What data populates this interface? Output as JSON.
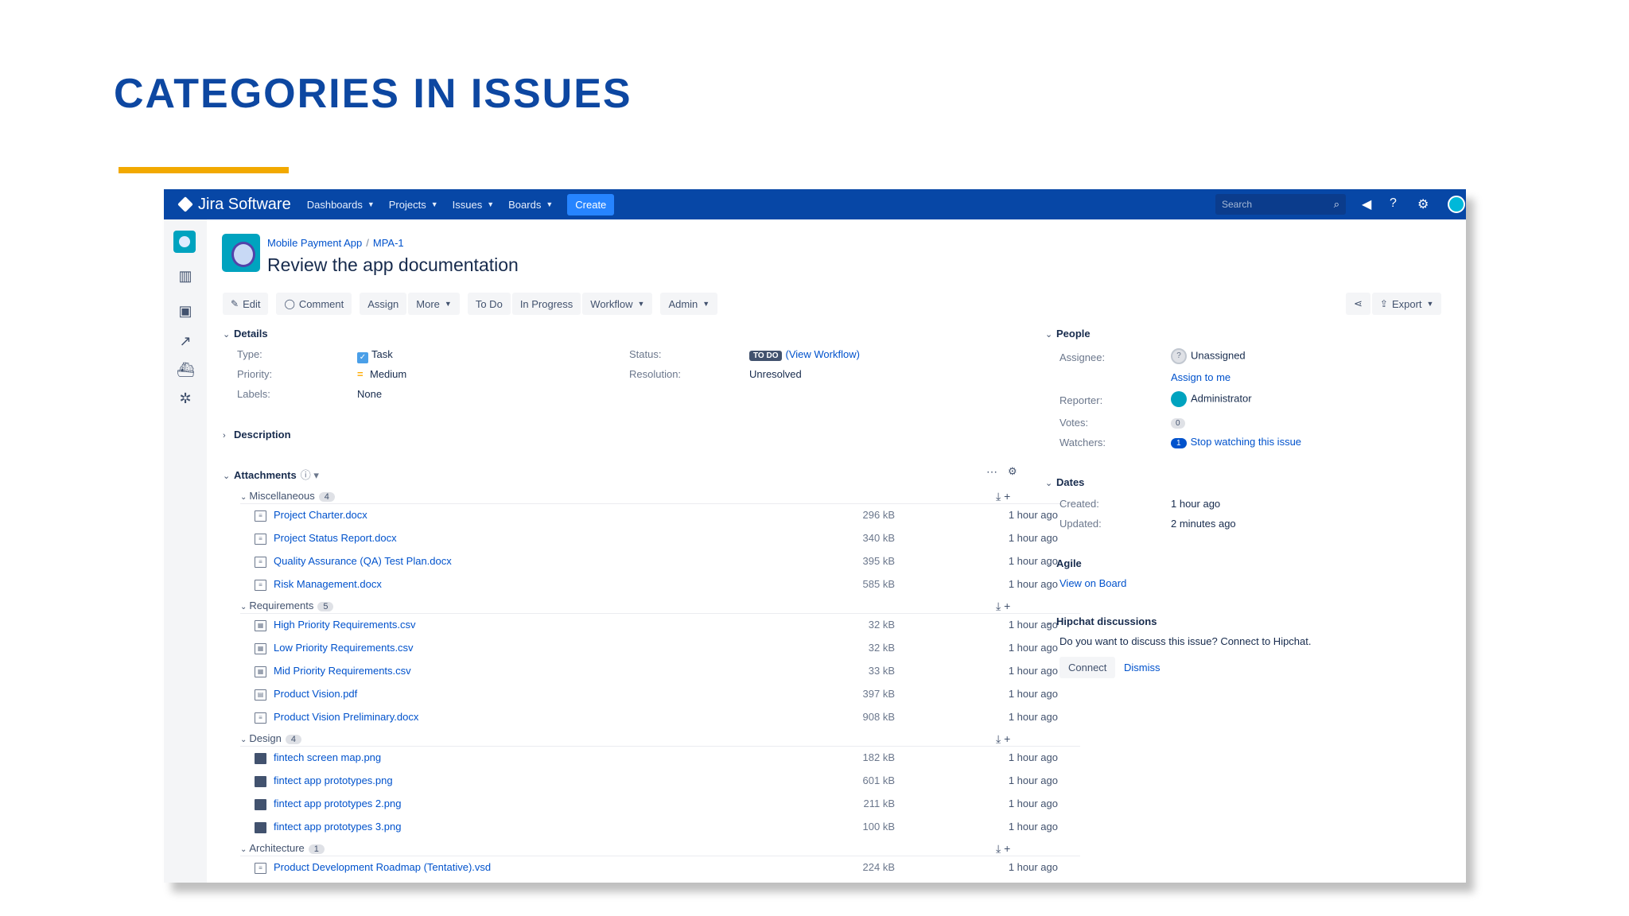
{
  "slide": {
    "title": "CATEGORIES IN ISSUES"
  },
  "nav": {
    "logo": "Jira Software",
    "items": [
      "Dashboards",
      "Projects",
      "Issues",
      "Boards"
    ],
    "create": "Create",
    "search_placeholder": "Search",
    "icons": [
      "megaphone-icon",
      "help-icon",
      "settings-icon",
      "user-avatar"
    ]
  },
  "sidebar": {
    "icons": [
      "project-avatar",
      "board-icon",
      "issues-icon",
      "reports-icon",
      "releases-icon",
      "addons-icon"
    ]
  },
  "issue": {
    "breadcrumb": {
      "project": "Mobile Payment App",
      "key": "MPA-1"
    },
    "title": "Review the app documentation"
  },
  "toolbar": {
    "edit": "Edit",
    "comment": "Comment",
    "assign": "Assign",
    "more": "More",
    "todo": "To Do",
    "in_progress": "In Progress",
    "workflow": "Workflow",
    "admin": "Admin",
    "export": "Export"
  },
  "details": {
    "heading": "Details",
    "type_label": "Type:",
    "type_value": "Task",
    "priority_label": "Priority:",
    "priority_value": "Medium",
    "labels_label": "Labels:",
    "labels_value": "None",
    "status_label": "Status:",
    "status_value": "TO DO",
    "status_link": "(View Workflow)",
    "resolution_label": "Resolution:",
    "resolution_value": "Unresolved"
  },
  "description": {
    "heading": "Description"
  },
  "attachments": {
    "heading": "Attachments",
    "groups": [
      {
        "name": "Miscellaneous",
        "count": "4",
        "files": [
          {
            "name": "Project Charter.docx",
            "size": "296 kB",
            "time": "1 hour ago"
          },
          {
            "name": "Project Status Report.docx",
            "size": "340 kB",
            "time": "1 hour ago"
          },
          {
            "name": "Quality Assurance (QA) Test Plan.docx",
            "size": "395 kB",
            "time": "1 hour ago"
          },
          {
            "name": "Risk Management.docx",
            "size": "585 kB",
            "time": "1 hour ago"
          }
        ]
      },
      {
        "name": "Requirements",
        "count": "5",
        "files": [
          {
            "name": "High Priority Requirements.csv",
            "size": "32 kB",
            "time": "1 hour ago"
          },
          {
            "name": "Low Priority Requirements.csv",
            "size": "32 kB",
            "time": "1 hour ago"
          },
          {
            "name": "Mid Priority Requirements.csv",
            "size": "33 kB",
            "time": "1 hour ago"
          },
          {
            "name": "Product Vision.pdf",
            "size": "397 kB",
            "time": "1 hour ago"
          },
          {
            "name": "Product Vision Preliminary.docx",
            "size": "908 kB",
            "time": "1 hour ago"
          }
        ]
      },
      {
        "name": "Design",
        "count": "4",
        "files": [
          {
            "name": "fintech screen map.png",
            "size": "182 kB",
            "time": "1 hour ago"
          },
          {
            "name": "fintect app prototypes.png",
            "size": "601 kB",
            "time": "1 hour ago"
          },
          {
            "name": "fintect app prototypes 2.png",
            "size": "211 kB",
            "time": "1 hour ago"
          },
          {
            "name": "fintect app prototypes 3.png",
            "size": "100 kB",
            "time": "1 hour ago"
          }
        ]
      },
      {
        "name": "Architecture",
        "count": "1",
        "files": [
          {
            "name": "Product Development Roadmap (Tentative).vsd",
            "size": "224 kB",
            "time": "1 hour ago"
          }
        ]
      }
    ]
  },
  "people": {
    "heading": "People",
    "assignee_label": "Assignee:",
    "assignee_value": "Unassigned",
    "assign_to_me": "Assign to me",
    "reporter_label": "Reporter:",
    "reporter_value": "Administrator",
    "votes_label": "Votes:",
    "votes_value": "0",
    "watchers_label": "Watchers:",
    "watchers_count": "1",
    "watchers_link": "Stop watching this issue"
  },
  "dates": {
    "heading": "Dates",
    "created_label": "Created:",
    "created_value": "1 hour ago",
    "updated_label": "Updated:",
    "updated_value": "2 minutes ago"
  },
  "agile": {
    "heading": "Agile",
    "link": "View on Board"
  },
  "hipchat": {
    "heading": "Hipchat discussions",
    "text": "Do you want to discuss this issue? Connect to Hipchat.",
    "connect": "Connect",
    "dismiss": "Dismiss"
  }
}
